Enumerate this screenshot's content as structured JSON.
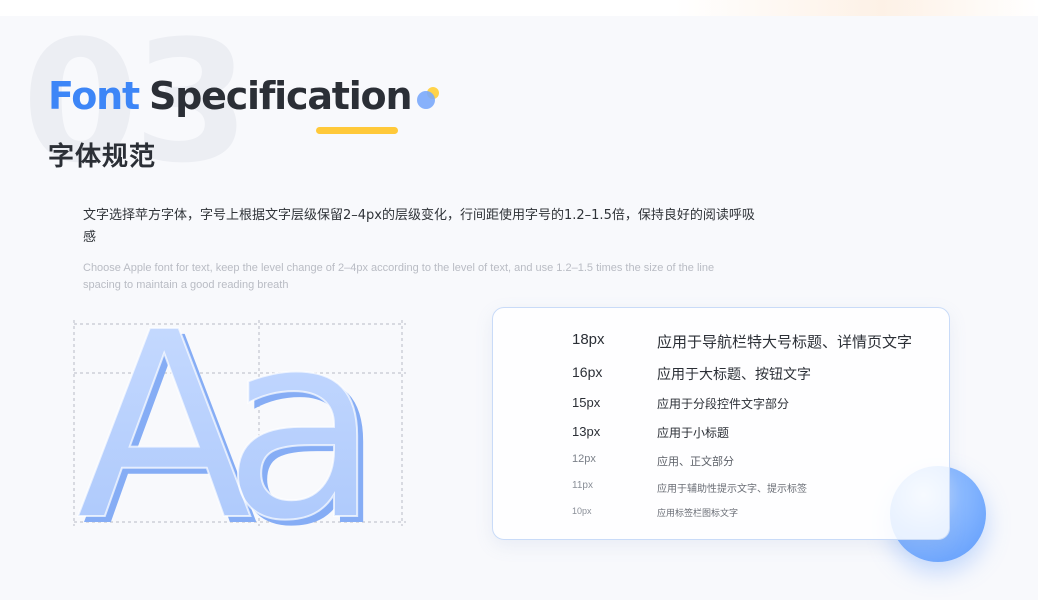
{
  "background_number": "03",
  "title": {
    "word1": "Font",
    "word2": "Specification"
  },
  "subtitle": "字体规范",
  "description_cn": "文字选择苹方字体，字号上根据文字层级保留2–4px的层级变化，行间距使用字号的1.2–1.5倍，保持良好的阅读呼吸感",
  "description_en": "Choose Apple font for text, keep the level change of 2–4px according to the level of text, and use 1.2–1.5 times the size of the line spacing to maintain a good reading breath",
  "sample_glyphs": "Aa",
  "specs": [
    {
      "size": "18px",
      "usage": "应用于导航栏特大号标题、详情页文字"
    },
    {
      "size": "16px",
      "usage": "应用于大标题、按钮文字"
    },
    {
      "size": "15px",
      "usage": "应用于分段控件文字部分"
    },
    {
      "size": "13px",
      "usage": "应用于小标题"
    },
    {
      "size": "12px",
      "usage": "应用、正文部分"
    },
    {
      "size": "11px",
      "usage": "应用于辅助性提示文字、提示标签"
    },
    {
      "size": "10px",
      "usage": "应用标签栏图标文字"
    }
  ],
  "colors": {
    "accent_blue": "#3d86f7",
    "accent_yellow": "#ffc93a",
    "text_dark": "#2b2f36",
    "text_muted": "#b9bcc4"
  }
}
